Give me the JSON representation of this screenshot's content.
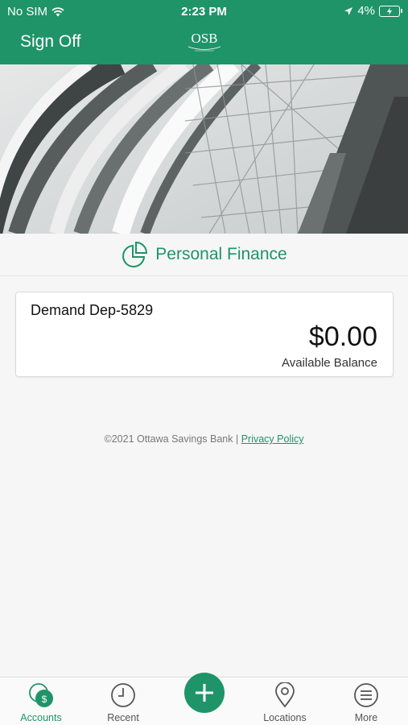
{
  "status_bar": {
    "carrier": "No SIM",
    "time": "2:23 PM",
    "battery": "4%"
  },
  "header": {
    "sign_off": "Sign Off",
    "logo_letters": "OSB"
  },
  "section": {
    "title": "Personal Finance"
  },
  "account": {
    "name": "Demand Dep-5829",
    "balance": "$0.00",
    "balance_label": "Available Balance"
  },
  "footer": {
    "copyright": "©2021 Ottawa Savings Bank |",
    "privacy": "Privacy Policy"
  },
  "tabs": [
    {
      "label": "Accounts",
      "icon": "accounts-icon",
      "active": true
    },
    {
      "label": "Recent",
      "icon": "clock-icon"
    },
    {
      "label": "",
      "icon": "plus-icon"
    },
    {
      "label": "Locations",
      "icon": "location-pin-icon"
    },
    {
      "label": "More",
      "icon": "menu-icon"
    }
  ],
  "colors": {
    "brand": "#1e9468",
    "background": "#f6f6f6"
  }
}
